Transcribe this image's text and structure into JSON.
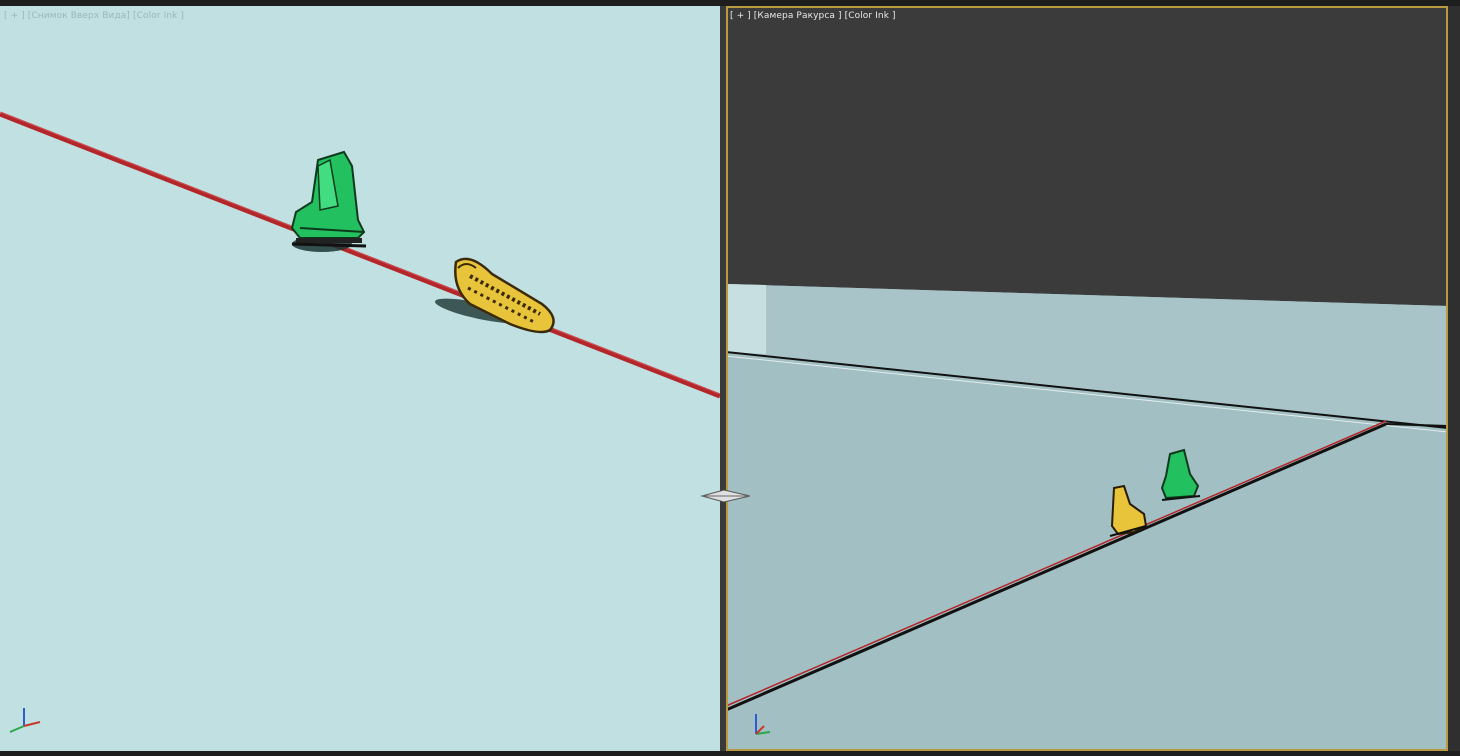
{
  "viewports": {
    "left": {
      "label_parts": [
        "[ + ]",
        "[Снимок Вверх Вида]",
        "[Color Ink ]"
      ],
      "background": "#c0e0e1",
      "axis_gizmo": "axis-tripod-icon"
    },
    "right": {
      "label_parts": [
        "[ + ]",
        "[Камера Ракурса ]",
        "[Color Ink ]"
      ],
      "background": "#a2bfc3",
      "sky_color": "#3b3b3b",
      "active_border_color": "#b79b3e",
      "axis_gizmo": "axis-tripod-icon"
    }
  },
  "scene": {
    "path_color": "#b3262a",
    "objects": [
      {
        "name": "green-ice-skate",
        "color": "#23c060"
      },
      {
        "name": "yellow-sneaker",
        "color": "#e8c43a"
      }
    ]
  },
  "icons": [
    "axis-tripod-icon",
    "viewport-splitter-icon"
  ]
}
